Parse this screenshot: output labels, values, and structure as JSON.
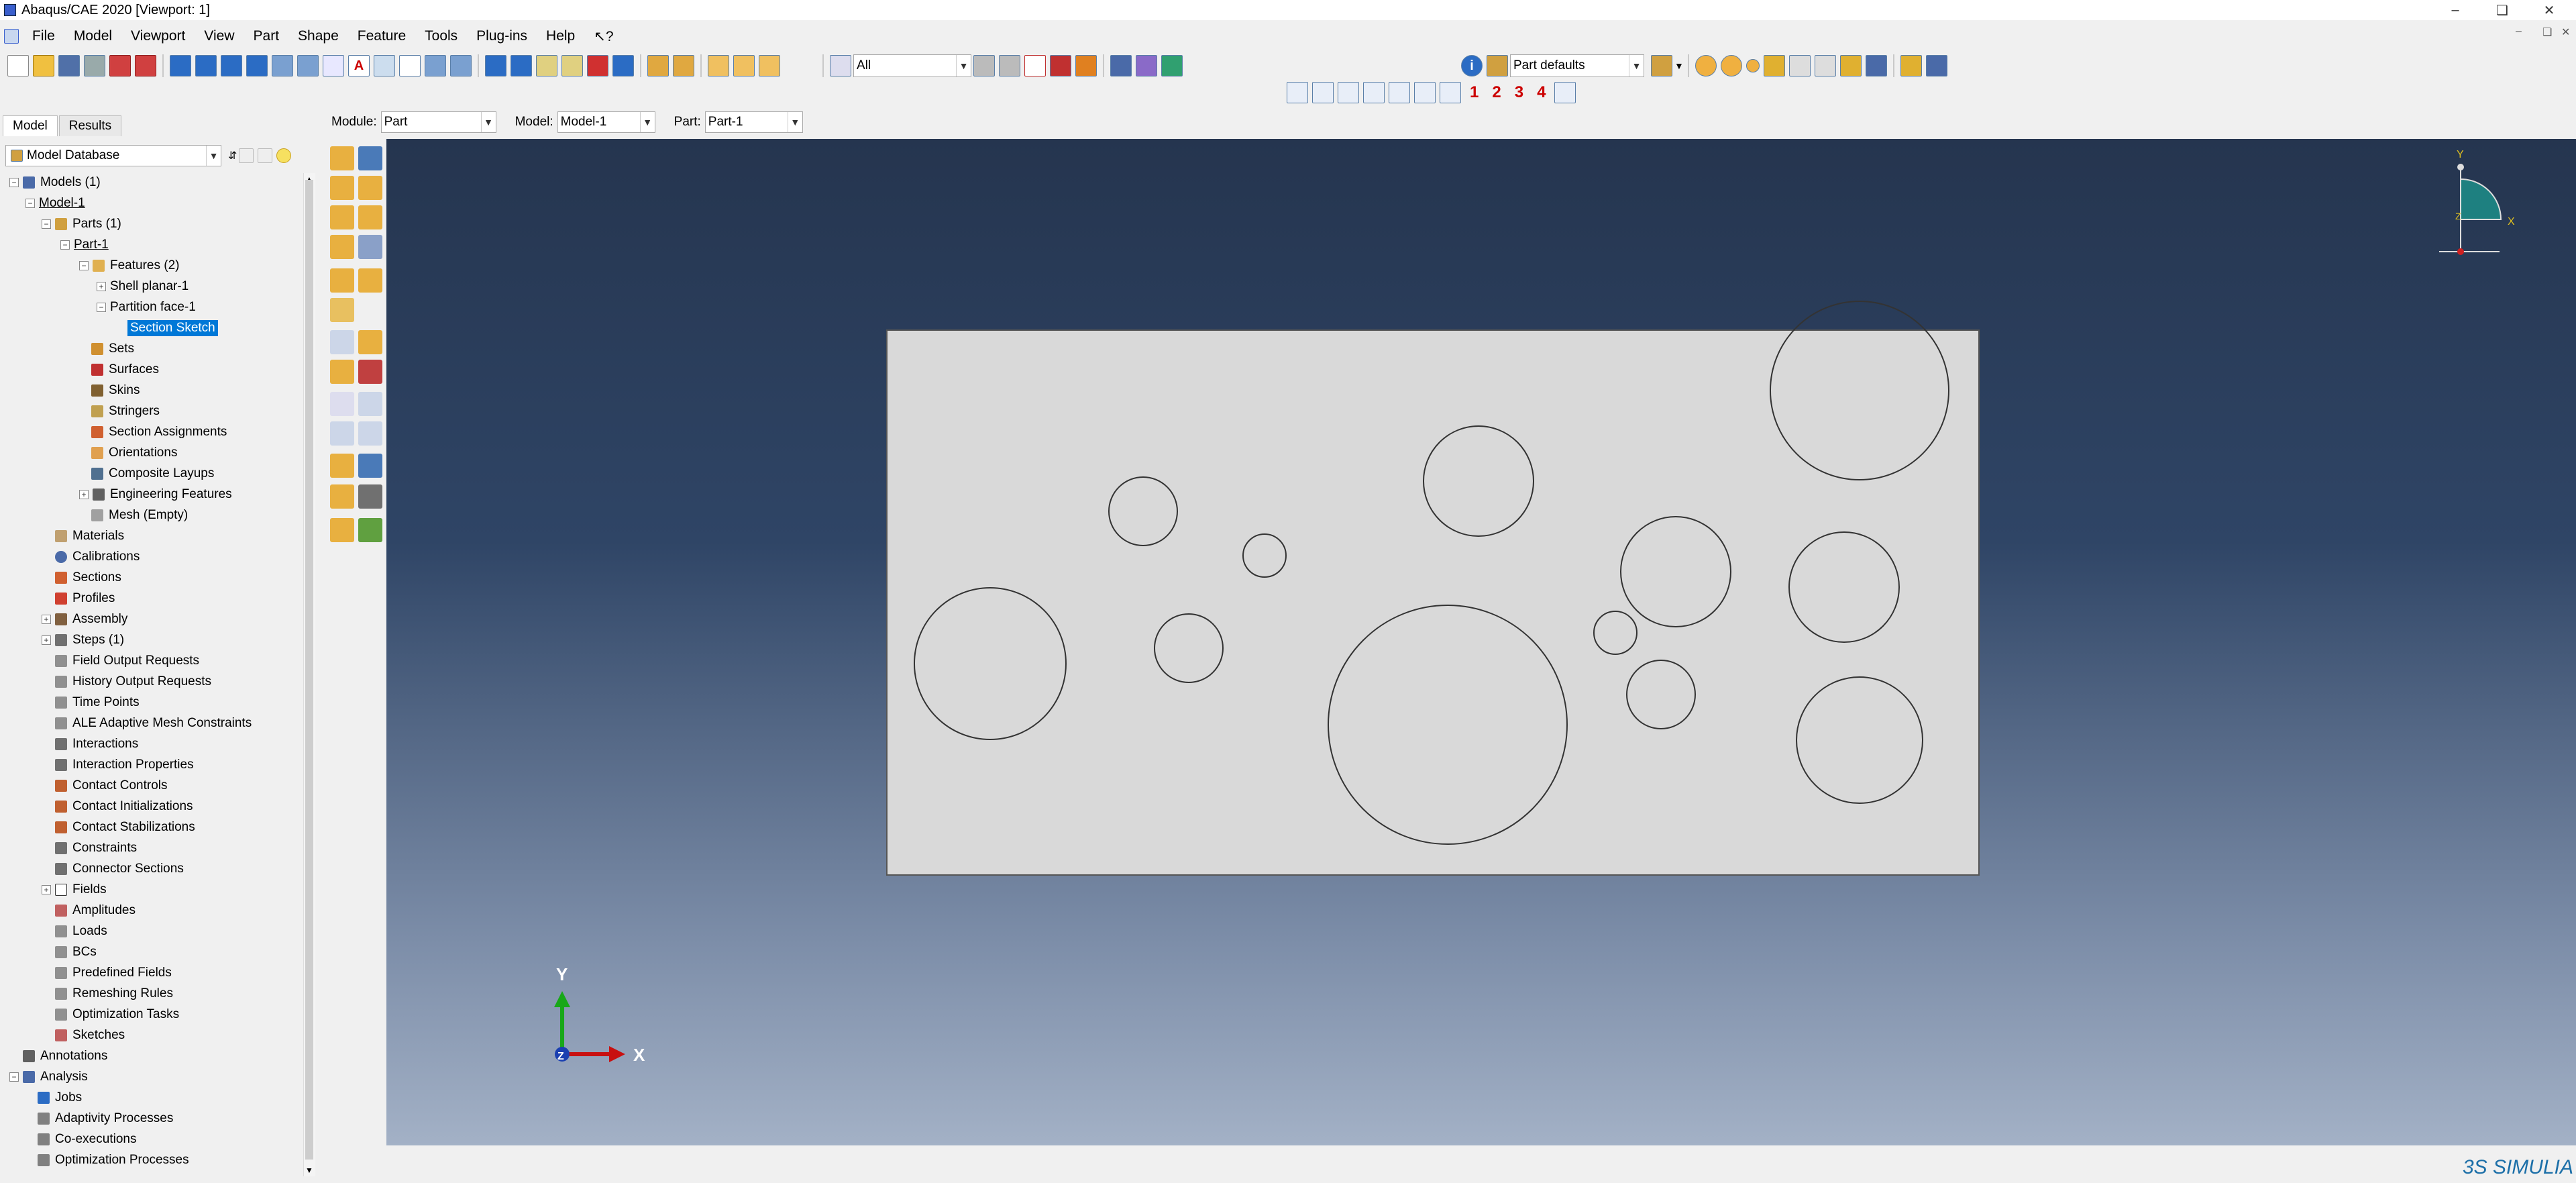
{
  "window": {
    "title": "Abaqus/CAE 2020 [Viewport: 1]",
    "minimize": "–",
    "restore": "❏",
    "close": "✕"
  },
  "menubar": {
    "items": [
      "File",
      "Model",
      "Viewport",
      "View",
      "Part",
      "Shape",
      "Feature",
      "Tools",
      "Plug-ins",
      "Help",
      "↖?"
    ]
  },
  "toolbar": {
    "selection_filter": "All",
    "part_defaults": "Part defaults",
    "info_icon": "i",
    "view_numbers": [
      "1",
      "2",
      "3",
      "4"
    ]
  },
  "context": {
    "module_label": "Module:",
    "module_value": "Part",
    "model_label": "Model:",
    "model_value": "Model-1",
    "part_label": "Part:",
    "part_value": "Part-1"
  },
  "tabs": [
    "Model",
    "Results"
  ],
  "tree_source": "Model Database",
  "tree": {
    "models": "Models (1)",
    "model1": "Model-1",
    "parts": "Parts (1)",
    "part1": "Part-1",
    "features": "Features (2)",
    "shell": "Shell planar-1",
    "partition": "Partition face-1",
    "sketch": "Section Sketch",
    "sets": "Sets",
    "surfaces": "Surfaces",
    "skins": "Skins",
    "stringers": "Stringers",
    "section_assignments": "Section Assignments",
    "orientations": "Orientations",
    "composite_layups": "Composite Layups",
    "engineering_features": "Engineering Features",
    "mesh": "Mesh (Empty)",
    "materials": "Materials",
    "calibrations": "Calibrations",
    "sections": "Sections",
    "profiles": "Profiles",
    "assembly": "Assembly",
    "steps": "Steps (1)",
    "field_output": "Field Output Requests",
    "history_output": "History Output Requests",
    "time_points": "Time Points",
    "ale": "ALE Adaptive Mesh Constraints",
    "interactions": "Interactions",
    "interaction_props": "Interaction Properties",
    "contact_controls": "Contact Controls",
    "contact_init": "Contact Initializations",
    "contact_stab": "Contact Stabilizations",
    "constraints": "Constraints",
    "connector_sections": "Connector Sections",
    "fields": "Fields",
    "amplitudes": "Amplitudes",
    "loads": "Loads",
    "bcs": "BCs",
    "predefined_fields": "Predefined Fields",
    "remeshing_rules": "Remeshing Rules",
    "optimization_tasks": "Optimization Tasks",
    "sketches": "Sketches",
    "annotations": "Annotations",
    "analysis": "Analysis",
    "jobs": "Jobs",
    "adaptivity": "Adaptivity Processes",
    "coexec": "Co-executions",
    "optim_proc": "Optimization Processes"
  },
  "triad": {
    "y": "Y",
    "x": "X",
    "z": "Z"
  },
  "mini_triad": {
    "y": "Y",
    "x": "X",
    "z": "Z"
  },
  "brand": "3S SIMULIA",
  "colors": {
    "viewport_top": "#25354f",
    "viewport_bottom": "#a3b1c6",
    "part_fill": "#d9d9d9",
    "selection": "#0078d7",
    "triad_x": "#c81010",
    "triad_y": "#18a818",
    "triad_z": "#1a3fb0"
  }
}
